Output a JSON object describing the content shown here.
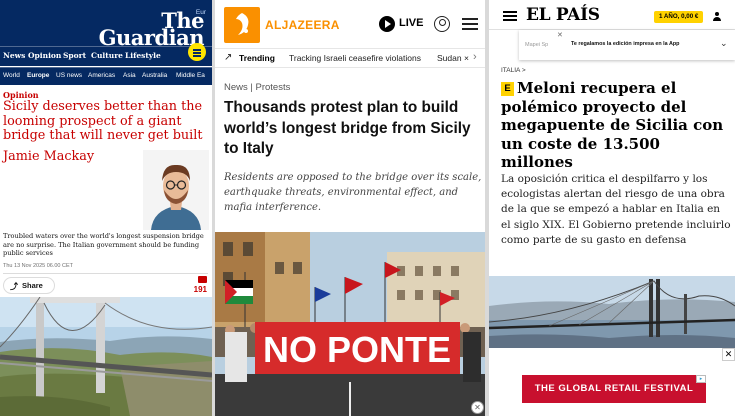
{
  "guardian": {
    "edition": "Eur",
    "logo": [
      "The",
      "Guardian"
    ],
    "nav": [
      "News",
      "Opinion",
      "Sport",
      "Culture",
      "Lifestyle"
    ],
    "subnav": [
      "World",
      "Europe",
      "US news",
      "Americas",
      "Asia",
      "Australia",
      "Middle Ea"
    ],
    "kicker": "Opinion",
    "headline": "Sicily deserves better than the looming prospect of a giant bridge that will never get built",
    "author": "Jamie Mackay",
    "standfirst": "Troubled waters over the world's longest suspension bridge are no surprise. The Italian government should be funding public services",
    "date": "Thu 13 Nov 2025 06.00 CET",
    "share_label": "Share",
    "comments": "191",
    "colors": {
      "brand": "#052962",
      "accent": "#c70000",
      "menu": "#ffe500"
    }
  },
  "aljazeera": {
    "logo_text": "ALJAZEERA",
    "live_label": "LIVE",
    "trending_label": "Trending",
    "trending_items": [
      "Tracking Israeli ceasefire violations",
      "Sudan ×"
    ],
    "crumbs": "News | Protests",
    "headline": "Thousands protest plan to build world’s longest bridge from Sicily to Italy",
    "summary": "Residents are opposed to the bridge over its scale, earthquake threats, environmental effect, and mafia interference.",
    "banner_text": "NO PONTE",
    "colors": {
      "brand": "#fa9000"
    }
  },
  "elpais": {
    "logo": "EL PAÍS",
    "subscribe": "1 AÑO, 0,00 €",
    "promo_map": "Mapei Sp",
    "promo_text": "Te regalamos la edición impresa en la App",
    "section": "ITALIA >",
    "badge": "E",
    "headline": "Meloni recupera el polémico proyecto del megapuente de Sicilia con un coste de 13.500 millones",
    "standfirst": "La oposición critica el despilfarro y los ecologistas alertan del riesgo de una obra de la que se empezó a hablar en Italia en el siglo XIX. El Gobierno pretende incluirlo como parte de su gasto en defensa",
    "ad_text": "THE GLOBAL RETAIL FESTIVAL",
    "colors": {
      "accent": "#ffd200",
      "ad": "#c8102e"
    }
  }
}
